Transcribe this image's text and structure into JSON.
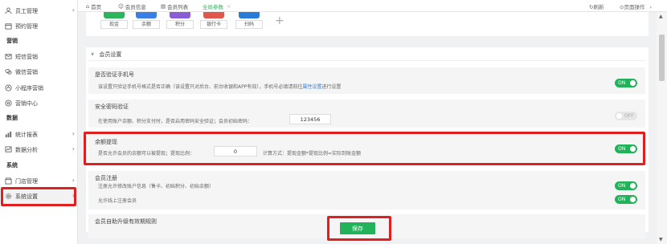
{
  "sidebar": {
    "items": [
      {
        "label": "员工管理",
        "icon": "user-icon"
      },
      {
        "label": "预约管理",
        "icon": "calendar-icon"
      },
      {
        "label": "短信营销",
        "icon": "mail-icon"
      },
      {
        "label": "微信营销",
        "icon": "wechat-icon"
      },
      {
        "label": "小程序营销",
        "icon": "miniprogram-icon"
      },
      {
        "label": "营销中心",
        "icon": "target-icon"
      },
      {
        "label": "统计报表",
        "icon": "chart-icon"
      },
      {
        "label": "数据分析",
        "icon": "analysis-icon"
      },
      {
        "label": "门店管理",
        "icon": "store-icon"
      },
      {
        "label": "系统设置",
        "icon": "gear-icon"
      }
    ],
    "sections": {
      "marketing": "营销",
      "data": "数据",
      "system": "系统"
    }
  },
  "topbar": {
    "tabs": [
      {
        "label": "首页"
      },
      {
        "label": "会员信息"
      },
      {
        "label": "会员列表"
      },
      {
        "label": "全局参数"
      }
    ],
    "refresh": "刷新",
    "page_ops": "页面操作"
  },
  "payments": [
    "现金",
    "余额",
    "积分",
    "银行卡",
    "扫码"
  ],
  "section_title": "会员设置",
  "settings": {
    "verify_phone": {
      "title": "是否验证手机号",
      "desc_pre": "该设置只验证手机号格式是否正确（该设置只对后台、前台收银和APP有效），手机号必填请前往",
      "desc_link": "属性设置",
      "desc_post": "进行设置",
      "toggle": "ON"
    },
    "secure_pwd": {
      "title": "安全密码验证",
      "desc": "在使用账户余额、积分支付时，是否启用密码安全验证；会员初始密码：",
      "value": "123456",
      "toggle": "OFF"
    },
    "withdraw": {
      "title": "余额提现",
      "desc": "是否允许会员的余额可以被提现；提现比例：",
      "value": "0",
      "calc": "计算方式：提现金额*提现比例=实际到账金额",
      "toggle": "ON"
    },
    "register": {
      "title": "会员注册",
      "desc1": "注册允许修改账户信息（售卡、初始积分、初始余额）",
      "desc2": "允许线上注册会员",
      "toggle1": "ON",
      "toggle2": "ON"
    },
    "auto_upgrade": {
      "title": "会员自助升级有效期规则"
    }
  },
  "save_label": "保存",
  "colors": {
    "accent": "#22b35a",
    "highlight": "#e02020",
    "link": "#2b7fd9"
  }
}
